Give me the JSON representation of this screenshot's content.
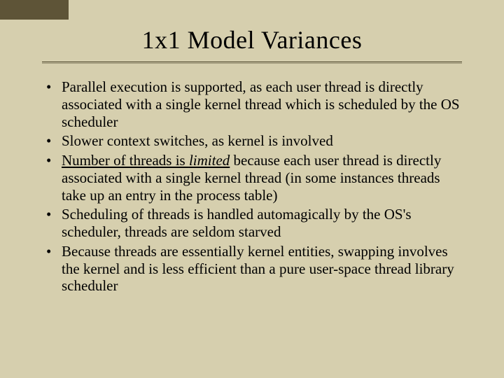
{
  "slide": {
    "title": "1x1 Model Variances",
    "bullets": [
      {
        "text": "Parallel execution is supported, as each user thread is directly associated with a single kernel thread which is scheduled by the OS scheduler"
      },
      {
        "text": "Slower context switches, as kernel is involved"
      },
      {
        "pre": "Number of threads is ",
        "em": "limited",
        "post": " because each user thread is directly associated with a single kernel thread (in some instances threads take up an entry in the process table)"
      },
      {
        "text": "Scheduling of threads is handled automagically by the OS's scheduler, threads are seldom starved"
      },
      {
        "text": "Because threads are essentially kernel entities, swapping involves the kernel and is less efficient than a pure user-space  thread library scheduler"
      }
    ]
  }
}
